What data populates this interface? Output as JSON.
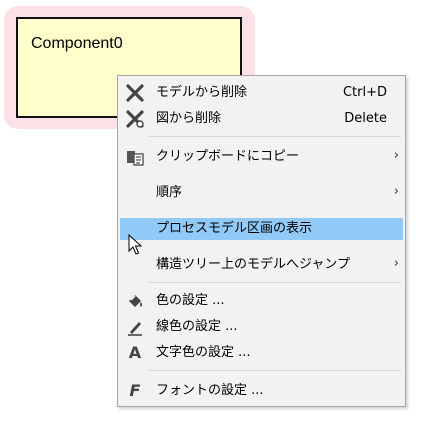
{
  "component": {
    "name": "Component0"
  },
  "menu": {
    "items": [
      {
        "label": "モデルから削除",
        "accel": "Ctrl+D",
        "icon": "delete-x-icon"
      },
      {
        "label": "図から削除",
        "accel": "Delete",
        "icon": "delete-x-icon"
      },
      {
        "label": "クリップボードにコピー",
        "icon": "clipboard-copy-icon",
        "submenu": "›"
      },
      {
        "label": "順序",
        "submenu": "›"
      },
      {
        "label": "プロセスモデル区画の表示",
        "highlighted": true
      },
      {
        "label": "構造ツリー上のモデルへジャンプ",
        "submenu": "›"
      },
      {
        "label": "色の設定 ...",
        "icon": "paint-bucket-icon"
      },
      {
        "label": "線色の設定 ...",
        "icon": "pen-icon"
      },
      {
        "label": "文字色の設定 ...",
        "icon": "letter-a-icon",
        "glyph": "A"
      },
      {
        "label": "フォントの設定 ...",
        "icon": "letter-f-icon",
        "glyph": "F"
      }
    ]
  },
  "colors": {
    "highlight": "#91c9f7",
    "component_fill": "#ffffcc",
    "component_halo": "#fce2e6"
  }
}
